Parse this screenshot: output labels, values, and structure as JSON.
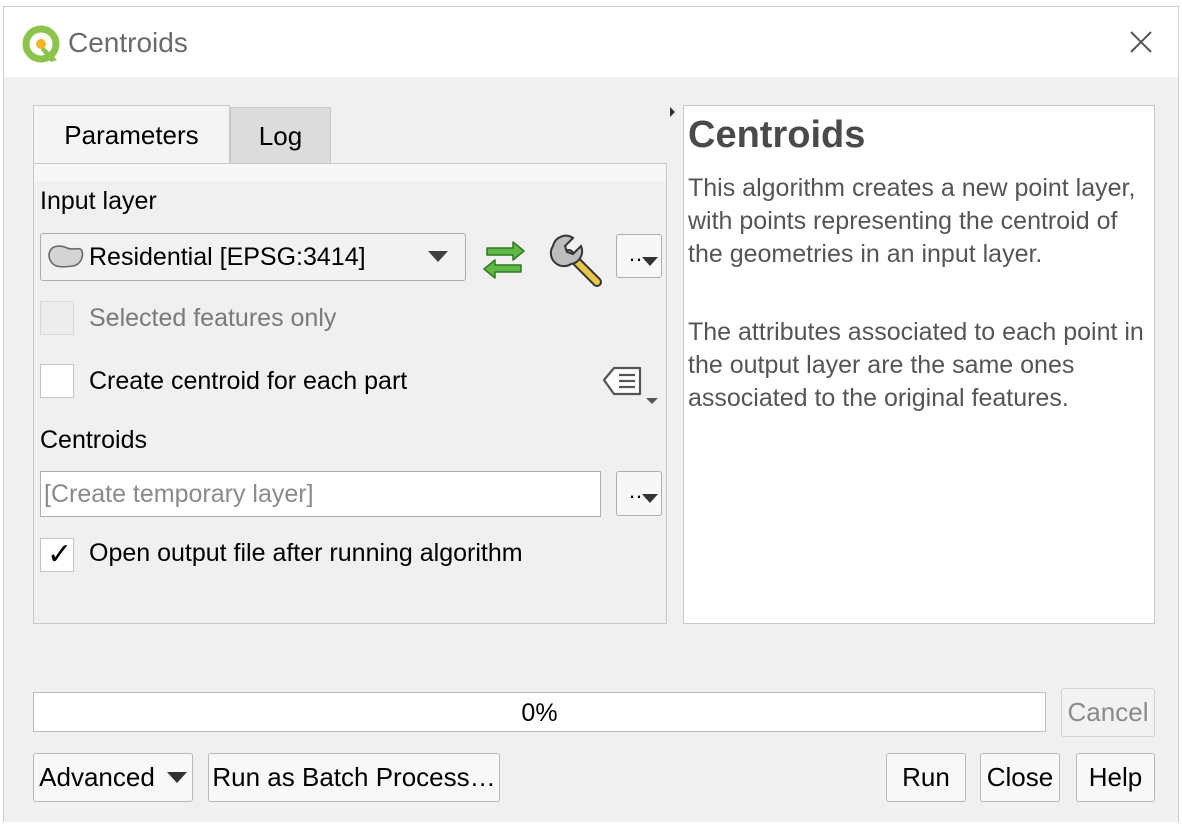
{
  "window": {
    "title": "Centroids",
    "app_icon": "qgis-logo-icon",
    "close_icon": "close-icon"
  },
  "tabs": [
    {
      "label": "Parameters",
      "active": true
    },
    {
      "label": "Log",
      "active": false
    }
  ],
  "params": {
    "input_layer_label": "Input layer",
    "input_layer_value": "Residential [EPSG:3414]",
    "input_layer_icon": "polygon-layer-icon",
    "iterate_icon": "iterate-icon",
    "settings_icon": "wrench-icon",
    "browse_label": "…",
    "selected_only_label": "Selected features only",
    "selected_only_checked": false,
    "selected_only_enabled": false,
    "each_part_label": "Create centroid for each part",
    "each_part_checked": false,
    "data_defined_icon": "data-defined-override-icon",
    "output_label": "Centroids",
    "output_placeholder": "[Create temporary layer]",
    "output_browse_label": "…",
    "open_output_label": "Open output file after running algorithm",
    "open_output_checked": true
  },
  "help": {
    "title": "Centroids",
    "p1": "This algorithm creates a new point layer, with points representing the centroid of the geometries in an input layer.",
    "p2": "The attributes associated to each point in the output layer are the same ones associated to the original features."
  },
  "progress": {
    "text": "0%",
    "fraction": 0
  },
  "buttons": {
    "cancel": "Cancel",
    "advanced": "Advanced",
    "batch": "Run as Batch Process…",
    "run": "Run",
    "close": "Close",
    "help": "Help"
  }
}
